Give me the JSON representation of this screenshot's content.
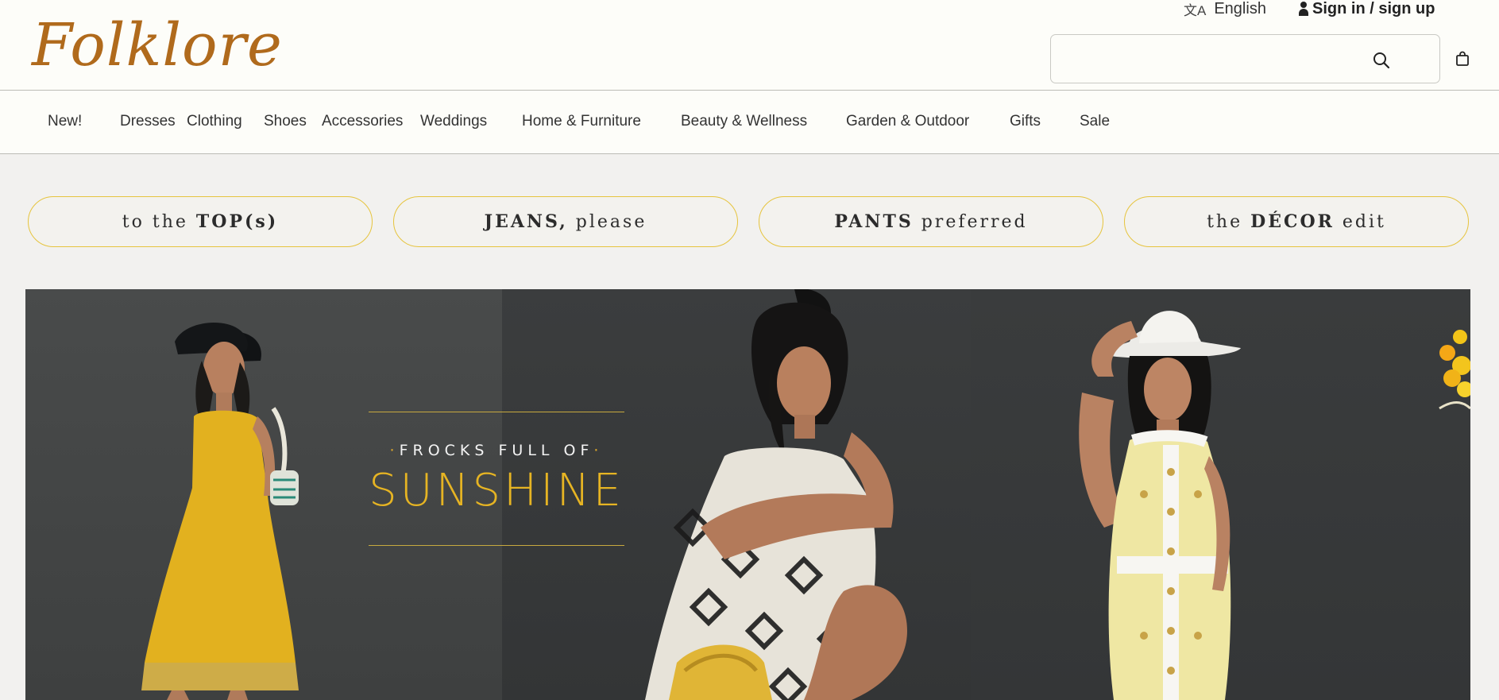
{
  "header": {
    "logo_text": "Folklore",
    "language_label": "English",
    "signin_label": "Sign in / sign up",
    "search": {
      "value": "",
      "placeholder": ""
    },
    "brand_color": "#b06a1c"
  },
  "nav": {
    "items": [
      {
        "label": "New!"
      },
      {
        "label": "Dresses"
      },
      {
        "label": "Clothing"
      },
      {
        "label": "Shoes"
      },
      {
        "label": "Accessories"
      },
      {
        "label": "Weddings"
      },
      {
        "label": "Home & Furniture"
      },
      {
        "label": "Beauty & Wellness"
      },
      {
        "label": "Garden & Outdoor"
      },
      {
        "label": "Gifts"
      },
      {
        "label": "Sale"
      }
    ]
  },
  "category_pills": [
    {
      "before": "to the ",
      "bold": "TOP(s)",
      "after": ""
    },
    {
      "before": "",
      "bold": "JEANS,",
      "after": " please"
    },
    {
      "before": "",
      "bold": "PANTS",
      "after": " preferred"
    },
    {
      "before": "the ",
      "bold": "DÉCOR",
      "after": " edit"
    }
  ],
  "hero": {
    "kicker": "FROCKS FULL OF",
    "headline": "SUNSHINE",
    "accent_color": "#e6b423",
    "pill_border_color": "#e6c43e"
  },
  "icons": [
    "translate-icon",
    "person-icon",
    "search-icon",
    "shopping-bag-icon"
  ]
}
